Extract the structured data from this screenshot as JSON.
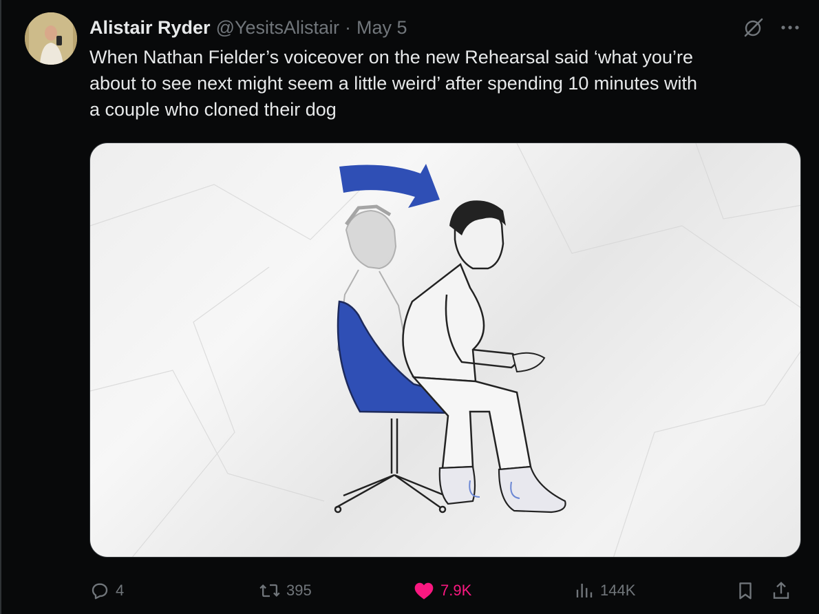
{
  "author": {
    "display_name": "Alistair Ryder",
    "handle": "@YesitsAlistair",
    "separator": "·",
    "date": "May 5"
  },
  "tweet": {
    "text": "When Nathan Fielder’s voiceover on the new Rehearsal said ‘what you’re\nabout to see next might seem a little weird’ after spending 10 minutes with\na couple who cloned their dog"
  },
  "actions": {
    "replies": "4",
    "reposts": "395",
    "likes": "7.9K",
    "views": "144K"
  },
  "icons": {
    "header": [
      "grok-icon",
      "more-icon"
    ],
    "actions": [
      "reply-icon",
      "retweet-icon",
      "heart-icon",
      "views-icon",
      "bookmark-icon",
      "share-icon"
    ]
  },
  "colors": {
    "background": "#08090a",
    "text": "#e7e9ea",
    "muted": "#71767b",
    "like": "#f91880",
    "illustration_blue": "#2f4fb5"
  }
}
